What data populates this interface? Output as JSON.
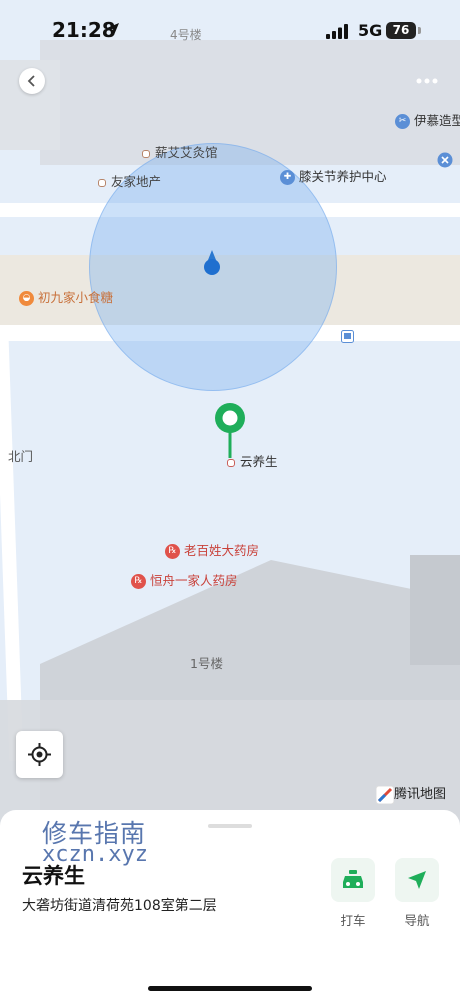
{
  "status_bar": {
    "time": "21:28",
    "network": "5G",
    "battery": "76",
    "floor_label": "4号楼"
  },
  "map": {
    "pois": [
      {
        "name": "薪艾艾灸馆",
        "kind": "dot"
      },
      {
        "name": "友家地产",
        "kind": "dot"
      },
      {
        "name": "膝关节养护中心",
        "kind": "medical"
      },
      {
        "name": "伊慕造型",
        "kind": "salon"
      },
      {
        "name": "初九家小食糖",
        "kind": "food"
      },
      {
        "name": "北门",
        "kind": "plain"
      },
      {
        "name": "云养生",
        "kind": "dot"
      },
      {
        "name": "老百姓大药房",
        "kind": "pharmacy"
      },
      {
        "name": "恒舟一家人药房",
        "kind": "pharmacy"
      },
      {
        "name": "1号楼",
        "kind": "plain"
      }
    ],
    "attribution": "腾讯地图",
    "colors": {
      "pin": "#1fae5a",
      "accuracy": "#78aff0",
      "pharmacy": "#e0524b",
      "food": "#f08a3c",
      "medical": "#5b8fd6"
    }
  },
  "sheet": {
    "watermark_cn": "修车指南",
    "watermark_url": "xczn.xyz",
    "place_name": "云养生",
    "address": "大砻坊街道清荷苑108室第二层",
    "actions": [
      {
        "label": "打车",
        "icon": "taxi-icon"
      },
      {
        "label": "导航",
        "icon": "navigate-arrow-icon"
      }
    ]
  }
}
